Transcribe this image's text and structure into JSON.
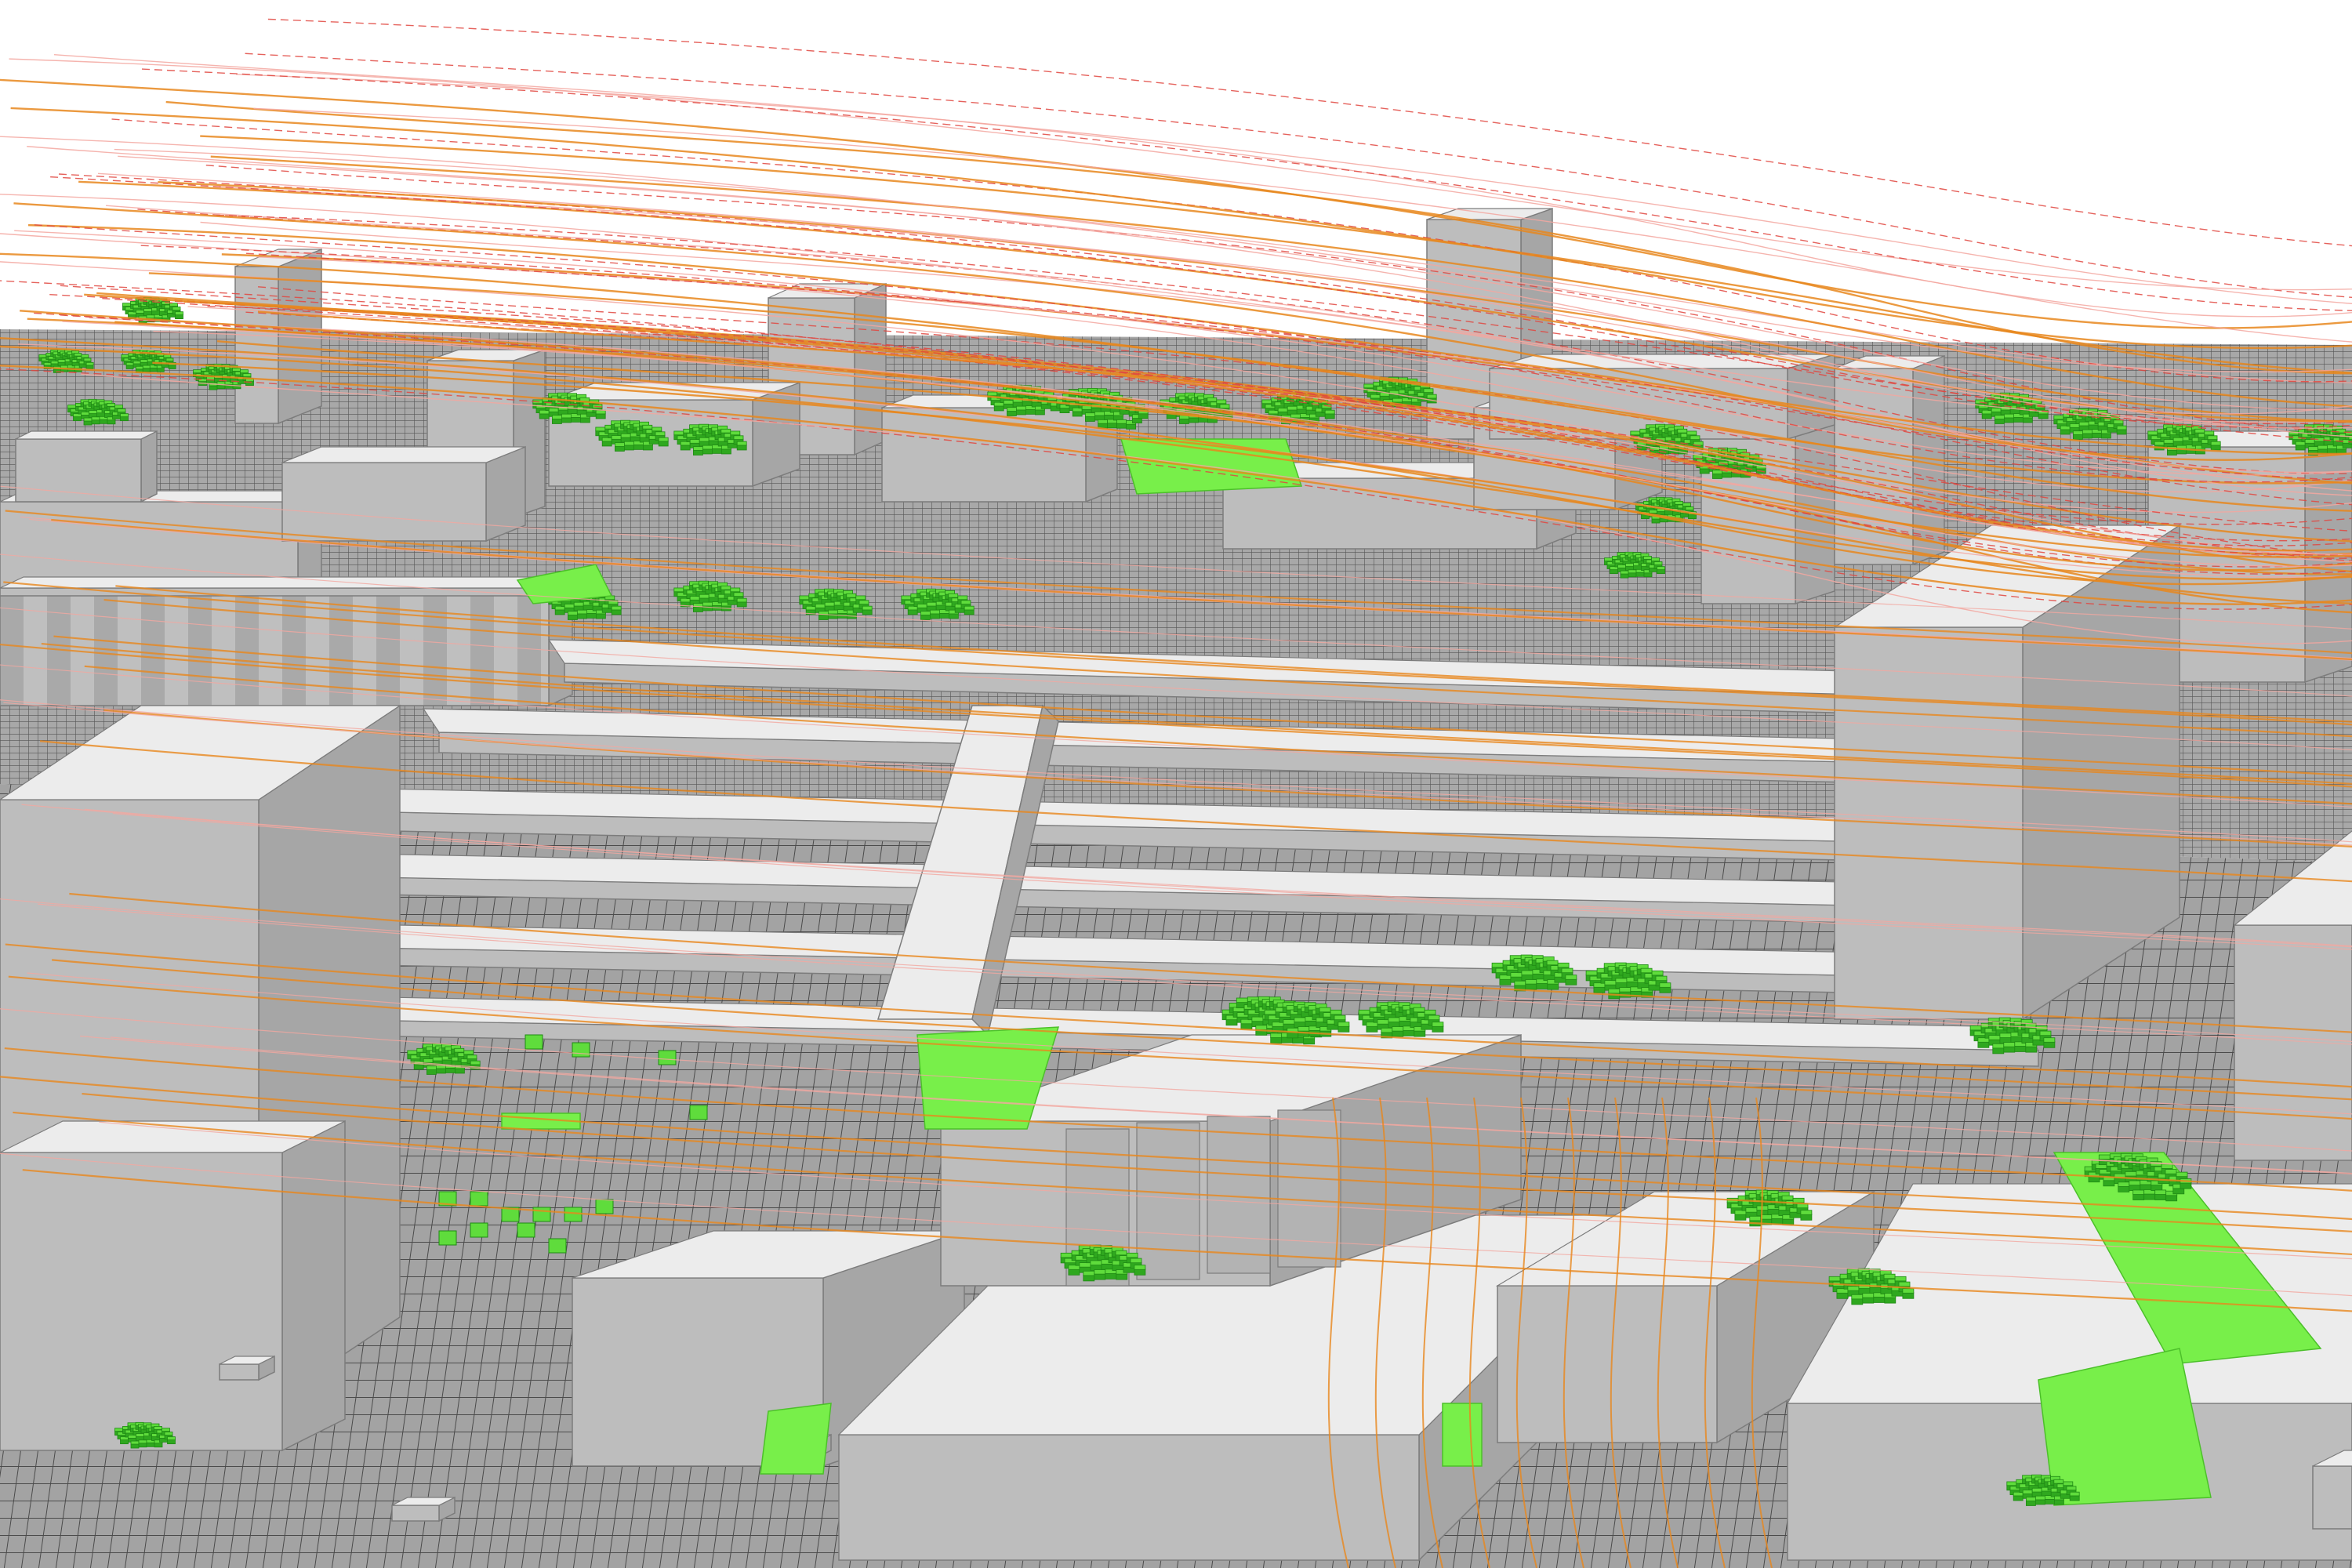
{
  "scene": {
    "kind": "voxel-urban-wind-simulation",
    "colors": {
      "background": "#ffffff",
      "ground": "#9a9a9a",
      "ground_grid": "#3a3a3a",
      "building_top": "#ececec",
      "building_left": "#bdbdbd",
      "building_right": "#a6a6a6",
      "building_edge": "#7c7c7c",
      "tree_top": "#5fdc3c",
      "tree_side": "#2fa81f",
      "tree_dark": "#1f8a14",
      "grass": "#78ef4a",
      "streamline_orange": "#e8871d",
      "streamline_red": "#e0463f",
      "streamline_pink": "#f3a7a0"
    },
    "icons": []
  }
}
